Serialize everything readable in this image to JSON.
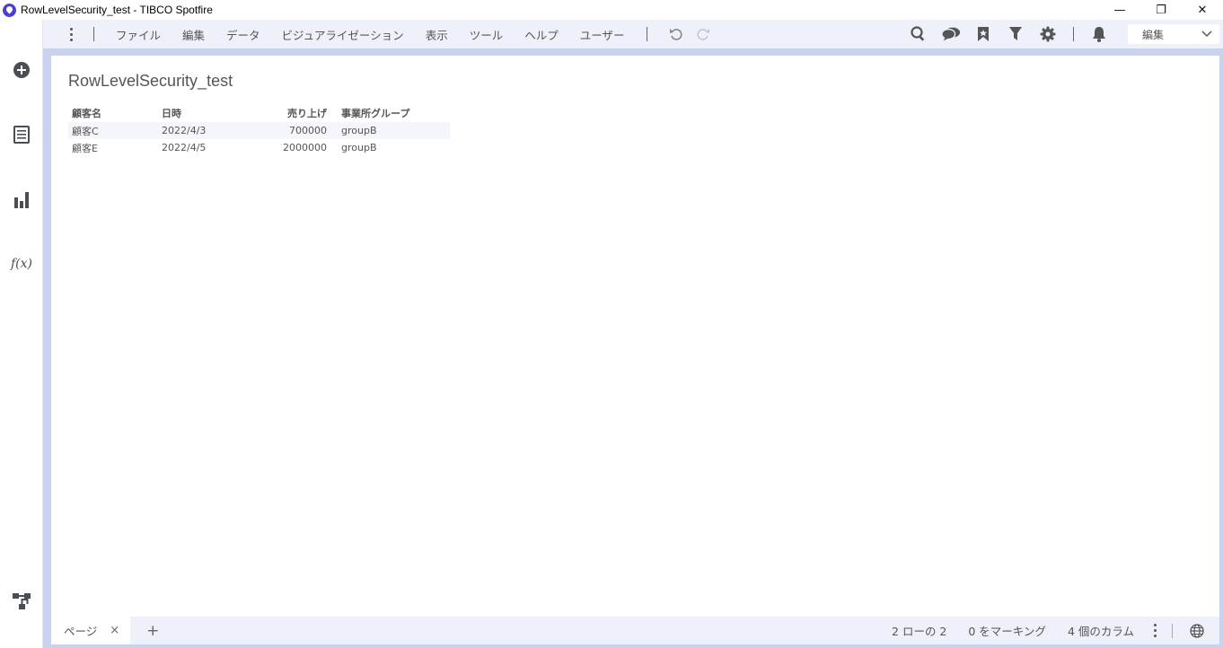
{
  "window": {
    "title": "RowLevelSecurity_test - TIBCO Spotfire",
    "minimize_glyph": "—",
    "restore_glyph": "❐",
    "close_glyph": "✕"
  },
  "sidebar": {
    "items": [
      {
        "icon": "add-circle-icon"
      },
      {
        "icon": "data-list-icon"
      },
      {
        "icon": "bar-chart-icon"
      },
      {
        "icon": "function-icon",
        "label": "f(x)"
      },
      {
        "icon": "data-flow-icon"
      }
    ]
  },
  "menubar": {
    "items": [
      "ファイル",
      "編集",
      "データ",
      "ビジュアライゼーション",
      "表示",
      "ツール",
      "ヘルプ",
      "ユーザー"
    ],
    "mode": "編集"
  },
  "visualization": {
    "title": "RowLevelSecurity_test",
    "columns": [
      "顧客名",
      "日時",
      "売り上げ",
      "事業所グループ"
    ],
    "rows": [
      [
        "顧客C",
        "2022/4/3",
        "700000",
        "groupB"
      ],
      [
        "顧客E",
        "2022/4/5",
        "2000000",
        "groupB"
      ]
    ]
  },
  "statusbar": {
    "page_tab": "ページ",
    "tab_close": "×",
    "add_page": "+",
    "rows_info": "2 ローの 2",
    "marking_info": "0 をマーキング",
    "columns_info": "4 個のカラム"
  },
  "colors": {
    "accent": "#4a3fd0",
    "menubar_bg": "#eef0fa",
    "frame_bg": "#c9d3ee"
  }
}
